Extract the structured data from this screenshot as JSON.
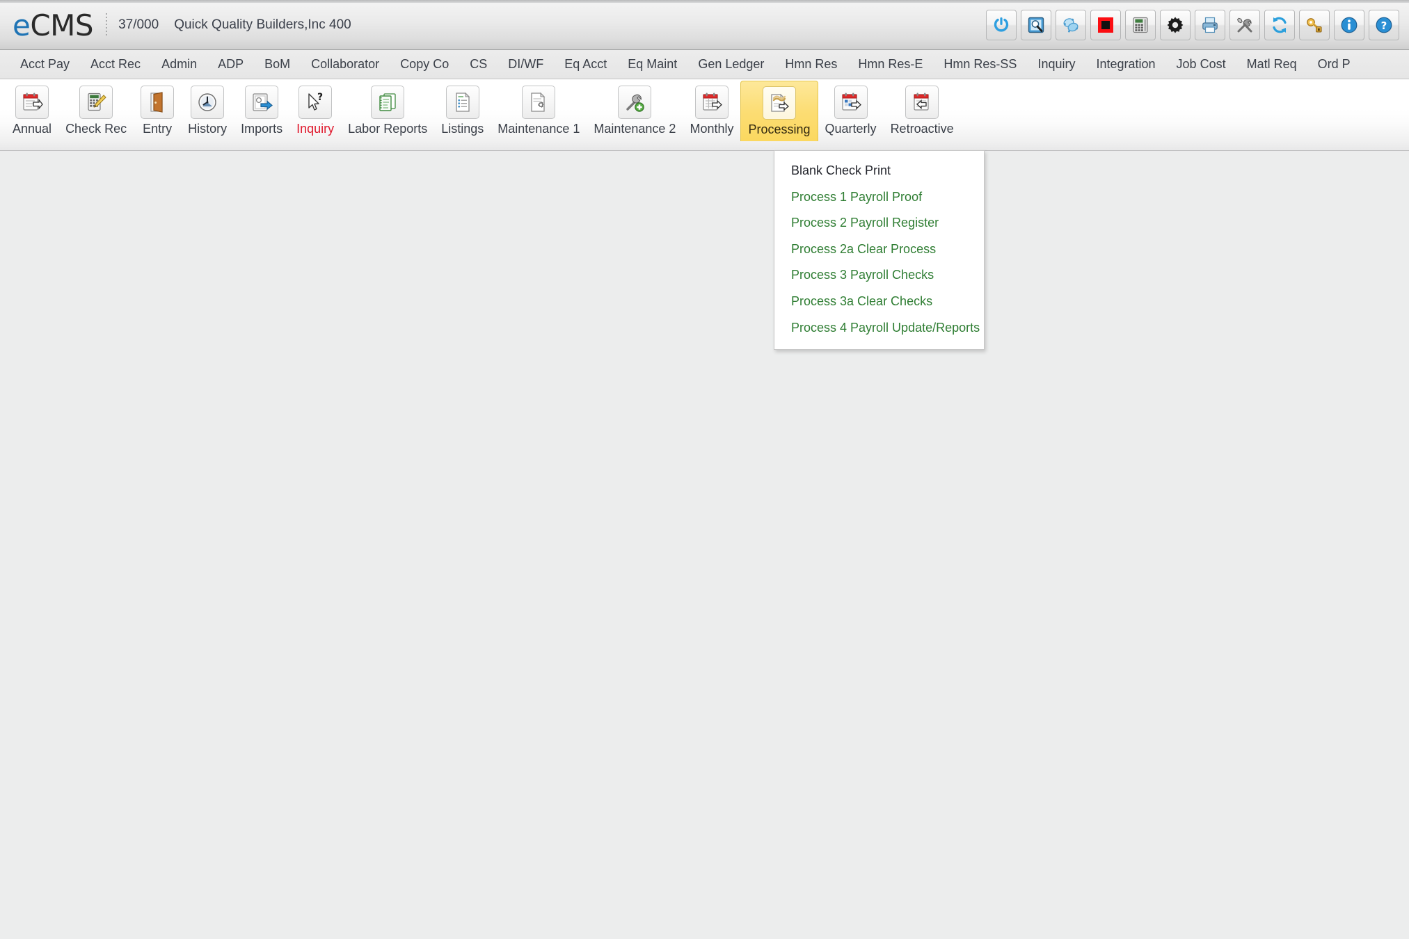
{
  "header": {
    "brand_prefix": "e",
    "brand_suffix": "CMS",
    "company_code": "37/000",
    "company_name": "Quick Quality Builders,Inc 400",
    "icons": [
      {
        "name": "power-icon",
        "title": "Sign Off"
      },
      {
        "name": "search-window-icon",
        "title": "Find"
      },
      {
        "name": "linked-objects-icon",
        "title": "Attachments"
      },
      {
        "name": "stop-red-icon",
        "title": "Stop"
      },
      {
        "name": "calculator-icon",
        "title": "Calculator"
      },
      {
        "name": "gear-icon",
        "title": "Settings"
      },
      {
        "name": "printer-icon",
        "title": "Print"
      },
      {
        "name": "tools-icon",
        "title": "Tools"
      },
      {
        "name": "refresh-sync-icon",
        "title": "Refresh"
      },
      {
        "name": "key-lock-icon",
        "title": "Security"
      },
      {
        "name": "info-icon",
        "title": "About"
      },
      {
        "name": "help-icon",
        "title": "Help"
      }
    ]
  },
  "module_bar": {
    "items": [
      {
        "label": "Acct Pay"
      },
      {
        "label": "Acct Rec"
      },
      {
        "label": "Admin"
      },
      {
        "label": "ADP"
      },
      {
        "label": "BoM"
      },
      {
        "label": "Collaborator"
      },
      {
        "label": "Copy Co"
      },
      {
        "label": "CS"
      },
      {
        "label": "DI/WF"
      },
      {
        "label": "Eq Acct"
      },
      {
        "label": "Eq Maint"
      },
      {
        "label": "Gen Ledger"
      },
      {
        "label": "Hmn Res"
      },
      {
        "label": "Hmn Res-E"
      },
      {
        "label": "Hmn Res-SS"
      },
      {
        "label": "Inquiry"
      },
      {
        "label": "Integration"
      },
      {
        "label": "Job Cost"
      },
      {
        "label": "Matl Req"
      },
      {
        "label": "Ord P"
      }
    ]
  },
  "toolbar": {
    "buttons": [
      {
        "label": "Annual",
        "icon": "calendar-forward-icon",
        "state": "normal"
      },
      {
        "label": "Check Rec",
        "icon": "calculator-pencil-icon",
        "state": "normal"
      },
      {
        "label": "Entry",
        "icon": "open-door-icon",
        "state": "normal"
      },
      {
        "label": "History",
        "icon": "clock-icon",
        "state": "normal"
      },
      {
        "label": "Imports",
        "icon": "import-arrow-icon",
        "state": "normal"
      },
      {
        "label": "Inquiry",
        "icon": "cursor-question-icon",
        "state": "accent"
      },
      {
        "label": "Labor Reports",
        "icon": "notebooks-icon",
        "state": "normal"
      },
      {
        "label": "Listings",
        "icon": "list-document-icon",
        "state": "normal"
      },
      {
        "label": "Maintenance 1",
        "icon": "document-gear-icon",
        "state": "normal"
      },
      {
        "label": "Maintenance 2",
        "icon": "wrench-plus-icon",
        "state": "normal"
      },
      {
        "label": "Monthly",
        "icon": "calendar-month-icon",
        "state": "normal"
      },
      {
        "label": "Processing",
        "icon": "processing-document-icon",
        "state": "active"
      },
      {
        "label": "Quarterly",
        "icon": "calendar-quarter-icon",
        "state": "normal"
      },
      {
        "label": "Retroactive",
        "icon": "calendar-back-icon",
        "state": "normal"
      }
    ]
  },
  "dropdown": {
    "owner": "Processing",
    "items": [
      {
        "label": "Blank Check Print",
        "style": "dark"
      },
      {
        "label": "Process 1 Payroll Proof",
        "style": "green"
      },
      {
        "label": "Process 2 Payroll Register",
        "style": "green"
      },
      {
        "label": "Process 2a Clear Process",
        "style": "green"
      },
      {
        "label": "Process 3 Payroll Checks",
        "style": "green"
      },
      {
        "label": "Process 3a Clear Checks",
        "style": "green"
      },
      {
        "label": "Process 4 Payroll Update/Reports",
        "style": "green"
      }
    ]
  },
  "colors": {
    "brand_blue": "#1f74b5",
    "accent_red": "#e0192d",
    "menu_green": "#2e7d32",
    "active_tab_yellow": "#fcdd74",
    "body_bg": "#eceded"
  }
}
